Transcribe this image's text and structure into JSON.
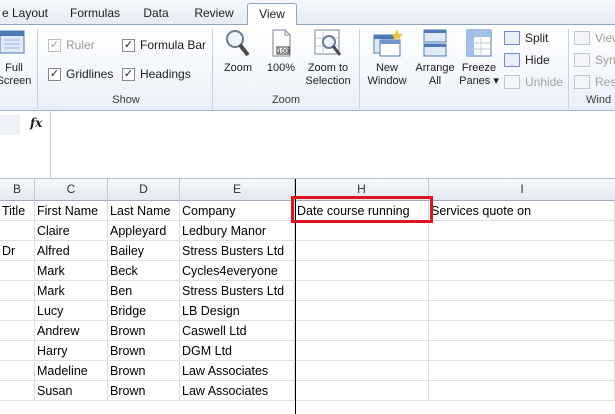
{
  "tabs": [
    "e Layout",
    "Formulas",
    "Data",
    "Review",
    "View"
  ],
  "active_tab": "View",
  "ribbon": {
    "full_screen": [
      "Full",
      "Screen"
    ],
    "show": {
      "label": "Show",
      "ruler": "Ruler",
      "gridlines": "Gridlines",
      "formula_bar": "Formula Bar",
      "headings": "Headings"
    },
    "zoom": {
      "label": "Zoom",
      "zoom": "Zoom",
      "hundred": "100%",
      "zoom_to_selection": [
        "Zoom to",
        "Selection"
      ]
    },
    "window": {
      "label": "Wind",
      "new_window": [
        "New",
        "Window"
      ],
      "arrange_all": [
        "Arrange",
        "All"
      ],
      "freeze_panes": [
        "Freeze",
        "Panes ▾"
      ],
      "split": "Split",
      "hide": "Hide",
      "unhide": "Unhide",
      "view_side": "View",
      "sync": "Syn",
      "reset": "Res"
    }
  },
  "formula_bar": {
    "fx": "fx"
  },
  "columns": [
    "B",
    "C",
    "D",
    "E",
    "H",
    "I"
  ],
  "header_row": {
    "B": "Title",
    "C": "First Name",
    "D": "Last Name",
    "E": "Company",
    "H": "Date course running",
    "I": "Services quote on"
  },
  "rows": [
    {
      "B": "",
      "C": "Claire",
      "D": "Appleyard",
      "E": "Ledbury Manor"
    },
    {
      "B": "Dr",
      "C": "Alfred",
      "D": "Bailey",
      "E": "Stress Busters Ltd"
    },
    {
      "B": "",
      "C": "Mark",
      "D": "Beck",
      "E": "Cycles4everyone"
    },
    {
      "B": "",
      "C": "Mark",
      "D": "Ben",
      "E": "Stress Busters Ltd"
    },
    {
      "B": "",
      "C": "Lucy",
      "D": "Bridge",
      "E": "LB Design"
    },
    {
      "B": "",
      "C": "Andrew",
      "D": "Brown",
      "E": "Caswell Ltd"
    },
    {
      "B": "",
      "C": "Harry",
      "D": "Brown",
      "E": "DGM Ltd"
    },
    {
      "B": "",
      "C": "Madeline",
      "D": "Brown",
      "E": "Law Associates"
    },
    {
      "B": "",
      "C": "Susan",
      "D": "Brown",
      "E": "Law Associates"
    }
  ]
}
